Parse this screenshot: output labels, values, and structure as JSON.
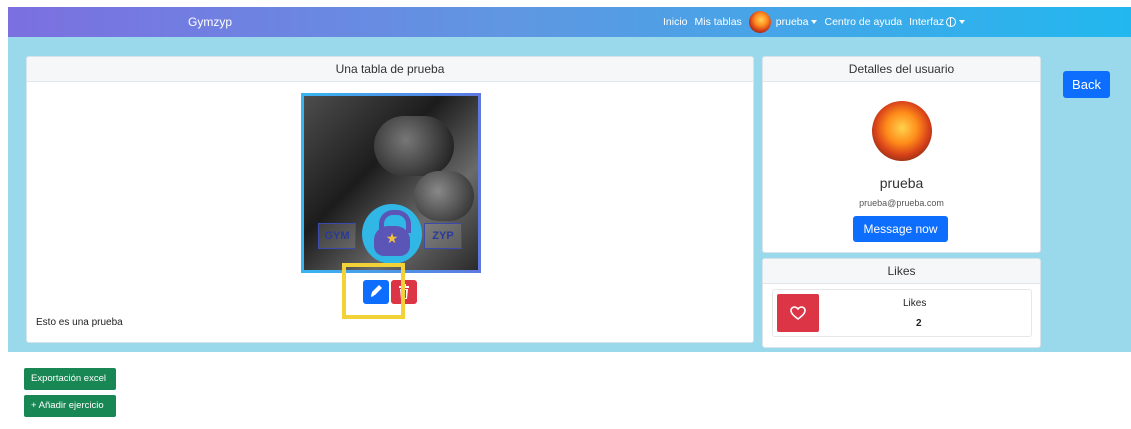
{
  "nav": {
    "brand": "Gymzyp",
    "links": [
      "Inicio",
      "Mis tablas"
    ],
    "user": "prueba",
    "help": "Centro de ayuda",
    "interface": "Interfaz"
  },
  "table": {
    "title": "Una tabla de prueba",
    "logo_left_text": "GYM",
    "logo_right_text": "ZYP",
    "description": "Esto es una prueba",
    "edit_icon": "pencil-icon",
    "delete_icon": "trash-icon",
    "highlight_color": "#f2d237"
  },
  "user": {
    "header": "Detalles del usuario",
    "name": "prueba",
    "email": "prueba@prueba.com",
    "message_button": "Message now"
  },
  "likes": {
    "header": "Likes",
    "label": "Likes",
    "count": "2"
  },
  "back_button": "Back",
  "actions": {
    "export": "Exportación excel",
    "add": "+ Añadir ejercicio"
  },
  "colors": {
    "primary": "#0d6efd",
    "danger": "#dc3545",
    "success": "#198754",
    "background": "#9ad8ec"
  }
}
